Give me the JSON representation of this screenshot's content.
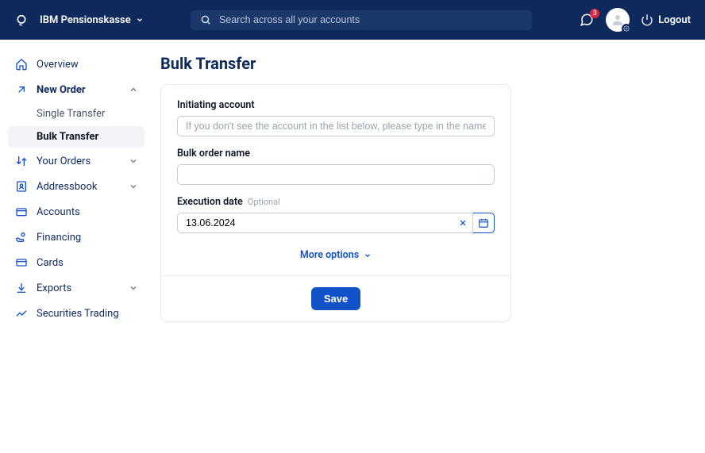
{
  "header": {
    "tenant": "IBM Pensionskasse",
    "search_placeholder": "Search across all your accounts",
    "notification_count": "3",
    "logout_label": "Logout"
  },
  "sidebar": {
    "overview": "Overview",
    "new_order": "New Order",
    "single_transfer": "Single Transfer",
    "bulk_transfer": "Bulk Transfer",
    "your_orders": "Your Orders",
    "addressbook": "Addressbook",
    "accounts": "Accounts",
    "financing": "Financing",
    "cards": "Cards",
    "exports": "Exports",
    "securities_trading": "Securities Trading"
  },
  "page": {
    "title": "Bulk Transfer"
  },
  "form": {
    "initiating_account_label": "Initiating account",
    "initiating_account_placeholder": "If you don't see the account in the list below, please type in the name.",
    "bulk_order_name_label": "Bulk order name",
    "bulk_order_name_value": "",
    "execution_date_label": "Execution date",
    "execution_date_optional": "Optional",
    "execution_date_value": "13.06.2024",
    "more_options_label": "More options",
    "save_label": "Save"
  },
  "colors": {
    "header_bg": "#0e2a5c",
    "accent": "#1152c9",
    "badge": "#d9263c"
  }
}
